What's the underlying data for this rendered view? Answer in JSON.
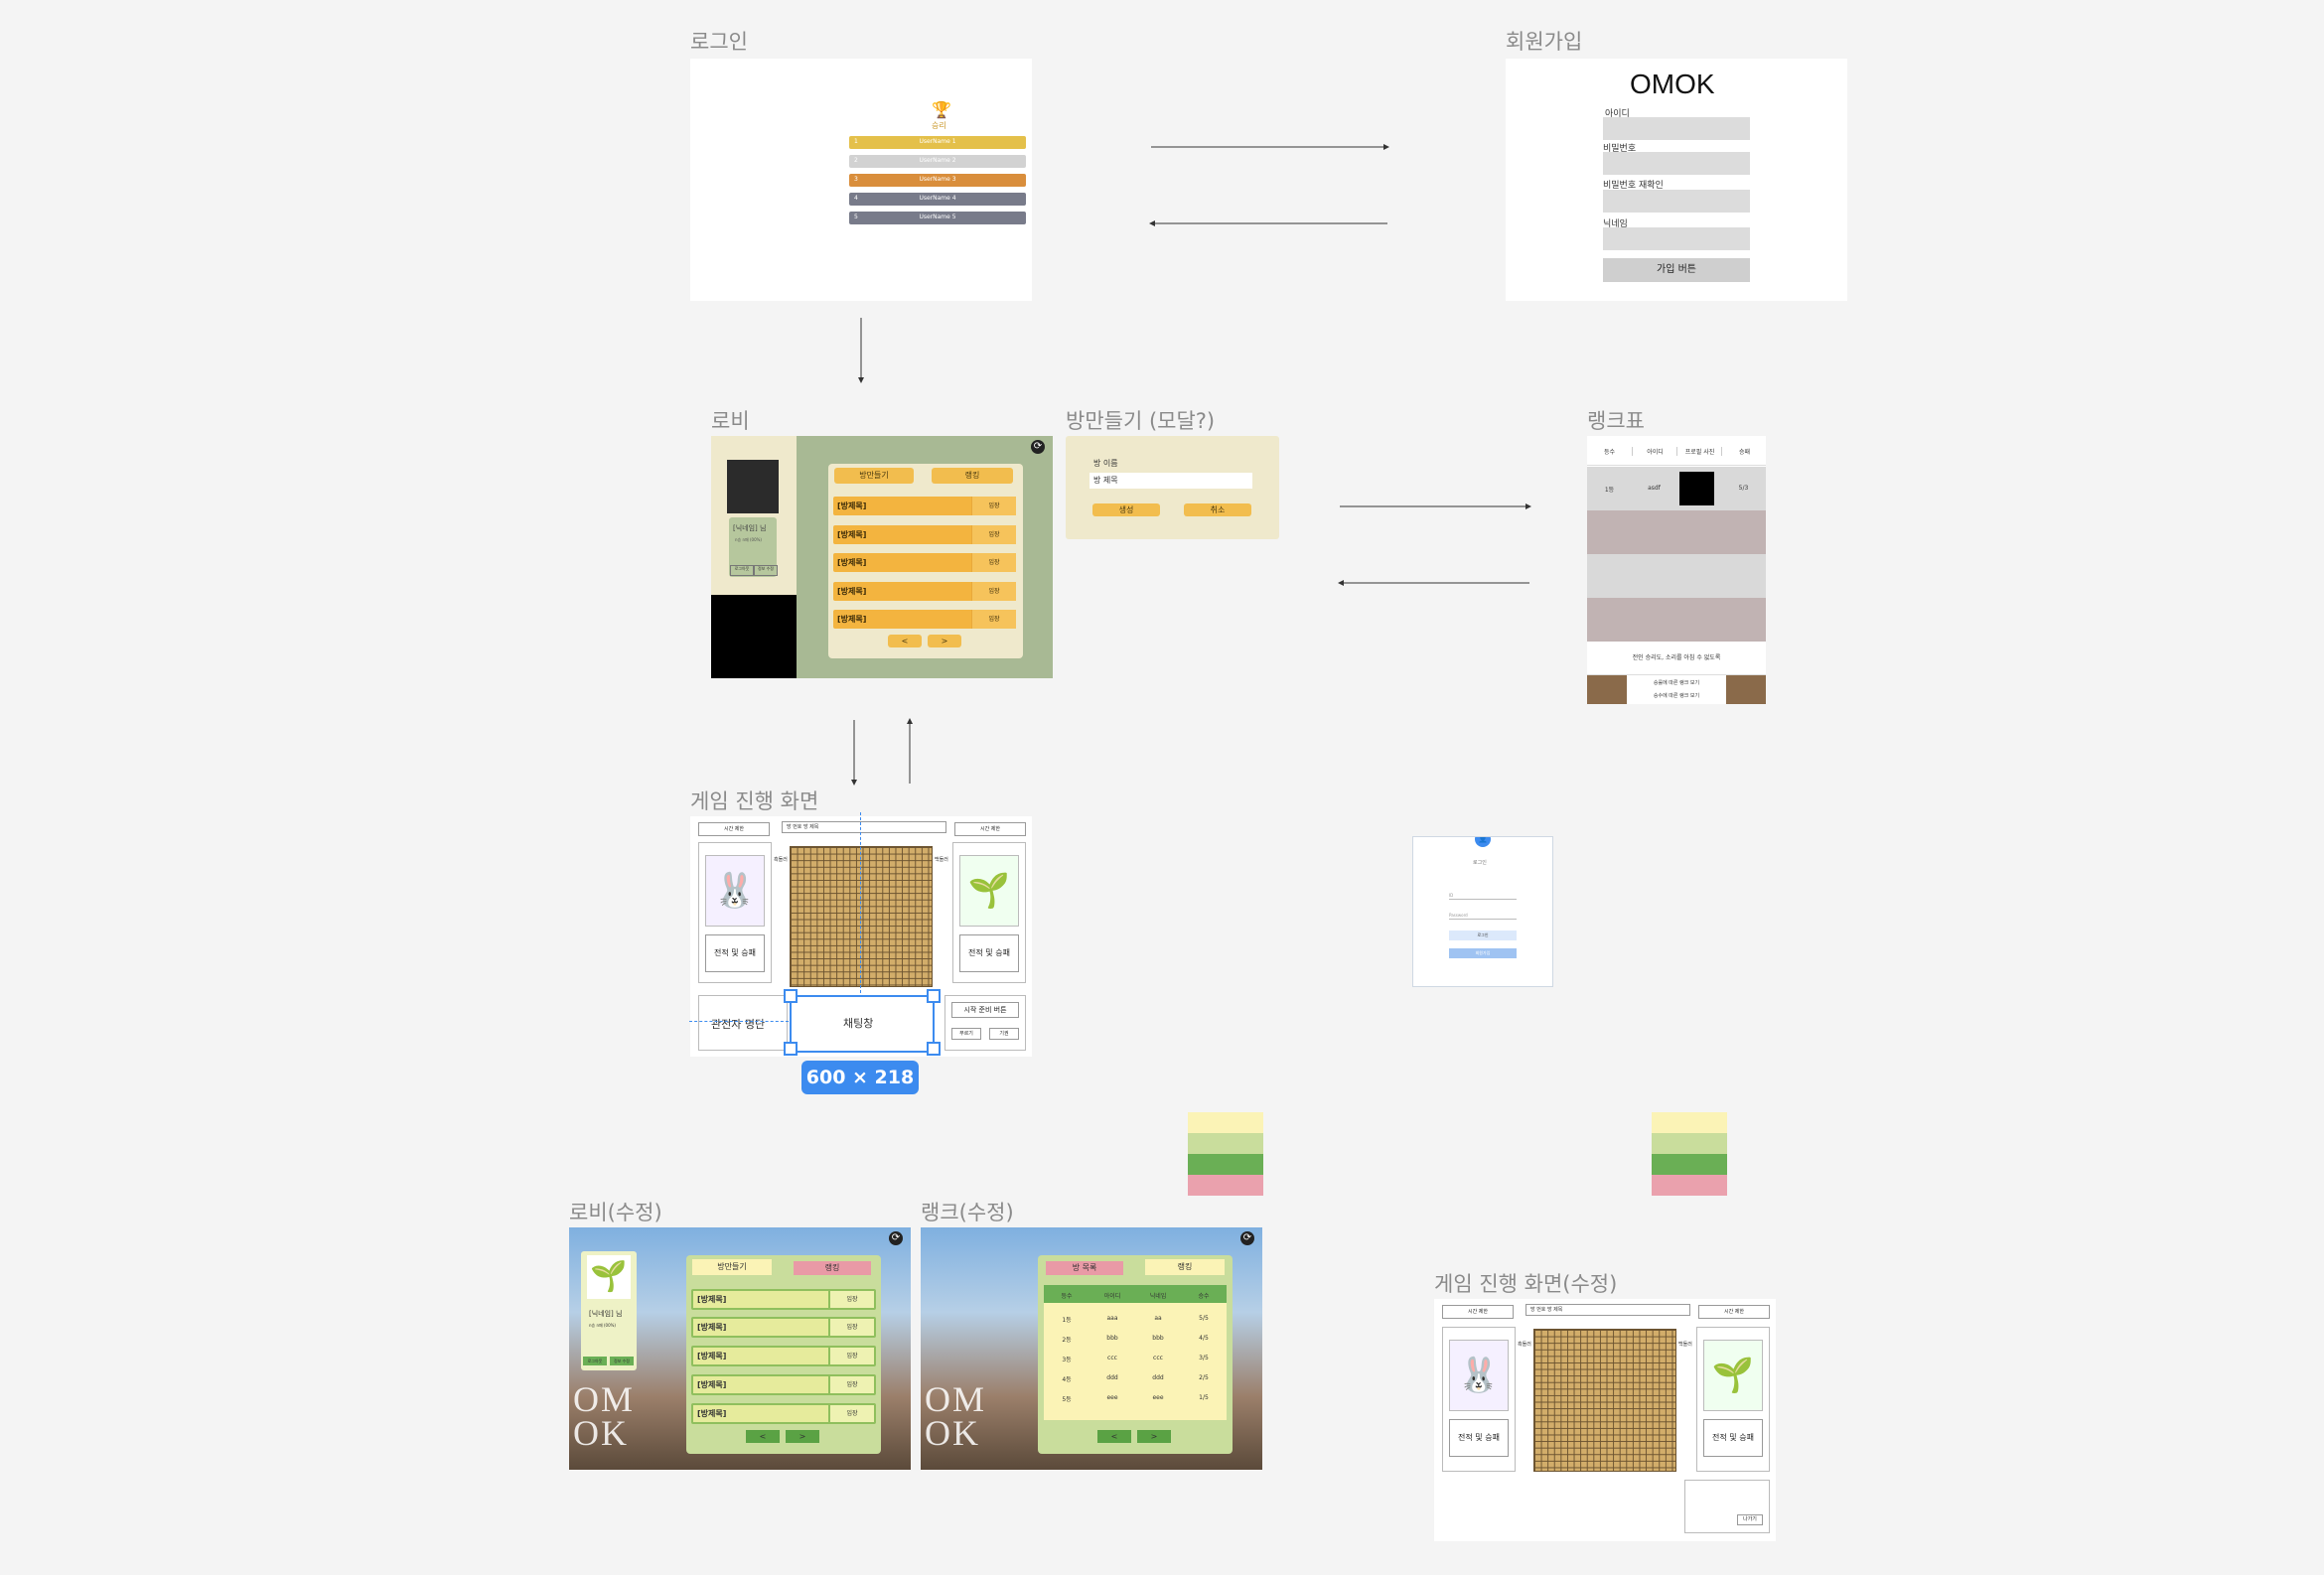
{
  "frames": {
    "login": {
      "label": "로그인",
      "ranking": {
        "title": "승리",
        "rows": [
          {
            "rank": "1",
            "name": "UserName 1",
            "color": "#e4c04a"
          },
          {
            "rank": "2",
            "name": "UserName 2",
            "color": "#d2d2d2"
          },
          {
            "rank": "3",
            "name": "UserName 3",
            "color": "#d98e3c"
          },
          {
            "rank": "4",
            "name": "UserName 4",
            "color": "#787b8a"
          },
          {
            "rank": "5",
            "name": "UserName 5",
            "color": "#787b8a"
          }
        ]
      }
    },
    "signup": {
      "label": "회원가입",
      "title": "OMOK",
      "fields": [
        "아이디",
        "비밀번호",
        "비밀번호 재확인",
        "닉네임"
      ],
      "submit": "가입 버튼"
    },
    "lobby": {
      "label": "로비",
      "profile_name": "[닉네임] 님",
      "profile_record": "n승 n패 (00%)",
      "profile_btn1": "로그아웃",
      "profile_btn2": "정보 수정",
      "tab_create": "방만들기",
      "tab_rank": "랭킹",
      "rooms": [
        "[방제목]",
        "[방제목]",
        "[방제목]",
        "[방제목]",
        "[방제목]"
      ],
      "enter": "입장",
      "prev": "<",
      "next": ">"
    },
    "create_room": {
      "label": "방만들기 (모달?)",
      "name_label": "방 이름",
      "name_value": "방 제목",
      "create": "생성",
      "cancel": "취소"
    },
    "rank_table": {
      "label": "랭크표",
      "headers": [
        "등수",
        "아이디",
        "프로필 사진",
        "승패"
      ],
      "first_row": [
        "1등",
        "asdf",
        "",
        "5/3"
      ],
      "notice": "전인 승리도, 소리를 아침 수 없도록",
      "btn1": "승률에 따른 랭크 보기",
      "btn2": "승수에 따른 랭크 보기"
    },
    "game": {
      "label": "게임 진행 화면",
      "time_left": "시간 제한",
      "time_right": "시간 제한",
      "title_bar": "방 번호    방 제목",
      "player_left": "흑돌러",
      "player_right": "백돌러",
      "record": "전적 및 승패",
      "spectators": "관전자 명단",
      "chat": "채팅창",
      "ready": "시작 준비 버튼",
      "btn_a": "무르기",
      "btn_b": "기권",
      "selection_size": "600 × 218"
    },
    "login_mock": {
      "title": "로그인",
      "id": "ID",
      "pw": "Password",
      "btn1": "로그인",
      "btn2": "회원가입"
    },
    "lobby_v2": {
      "label": "로비(수정)",
      "profile_name": "[닉네임] 님",
      "profile_record": "n승 n패 (00%)",
      "profile_btn1": "로그아웃",
      "profile_btn2": "정보 수정",
      "tab_create": "방만들기",
      "tab_rank": "랭킹",
      "logo": "OM OK",
      "rooms": [
        "[방제목]",
        "[방제목]",
        "[방제목]",
        "[방제목]",
        "[방제목]"
      ],
      "enter": "입장",
      "prev": "<",
      "next": ">"
    },
    "rank_v2": {
      "label": "랭크(수정)",
      "tab_room": "방 목록",
      "tab_rank": "랭킹",
      "logo": "OM OK",
      "headers": [
        "등수",
        "아이디",
        "닉네임",
        "승수"
      ],
      "rows": [
        [
          "1등",
          "aaa",
          "aa",
          "5/5"
        ],
        [
          "2등",
          "bbb",
          "bbb",
          "4/5"
        ],
        [
          "3등",
          "ccc",
          "ccc",
          "3/5"
        ],
        [
          "4등",
          "ddd",
          "ddd",
          "2/5"
        ],
        [
          "5등",
          "eee",
          "eee",
          "1/5"
        ]
      ],
      "prev": "<",
      "next": ">"
    },
    "game_v2": {
      "label": "게임 진행 화면(수정)",
      "time_left": "시간 제한",
      "time_right": "시간 제한",
      "title_bar": "방 번호    방 제목",
      "player_left": "흑돌러",
      "player_right": "백돌러",
      "record": "전적 및 승패",
      "exit": "나가기"
    }
  },
  "palette": [
    "#fbf3b6",
    "#c9dd9c",
    "#6aaf55",
    "#eaa1ad"
  ],
  "colors": {
    "lobby_bg": "#a8b994",
    "lobby_side": "#efe9cc",
    "yellow": "#f2bd4e",
    "accent_blue": "#3c8bef",
    "pink": "#e99aa6",
    "green": "#5aa244"
  }
}
